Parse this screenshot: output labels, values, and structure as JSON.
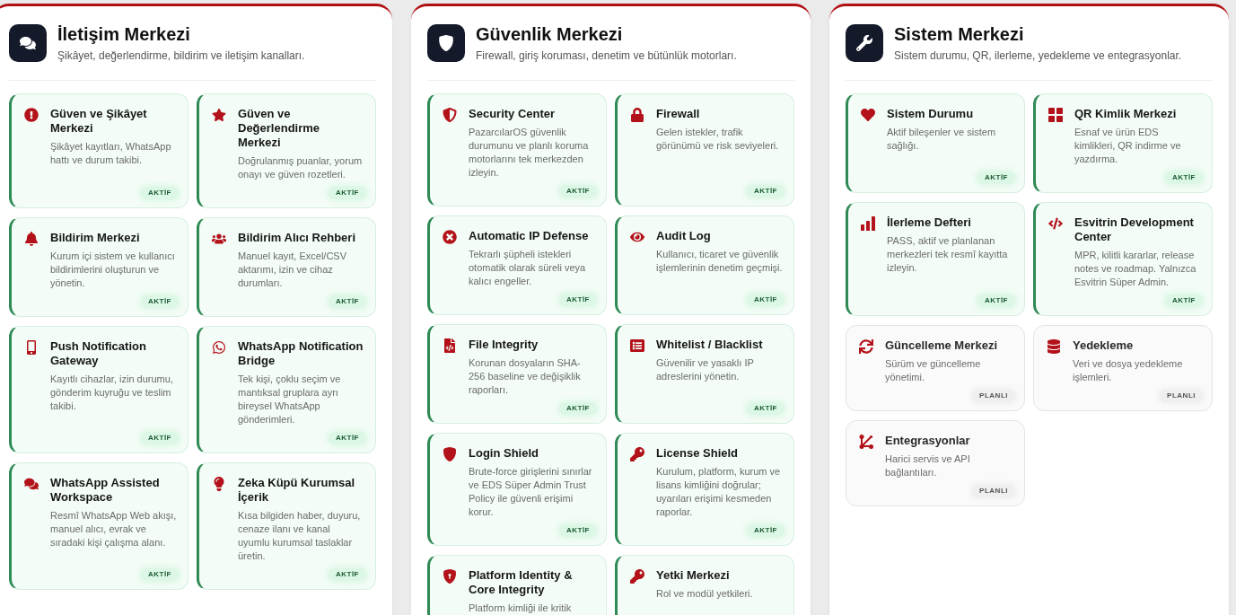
{
  "panels": [
    {
      "title": "İletişim Merkezi",
      "subtitle": "Şikâyet, değerlendirme, bildirim ve iletişim kanalları.",
      "cards": [
        {
          "title": "Güven ve Şikâyet Merkezi",
          "description": "Şikâyet kayıtları, WhatsApp hattı ve durum takibi.",
          "kind": "active",
          "badge": "AKTİF"
        },
        {
          "title": "Güven ve Değerlendirme Merkezi",
          "description": "Doğrulanmış puanlar, yorum onayı ve güven rozetleri.",
          "kind": "active",
          "badge": "AKTİF"
        },
        {
          "title": "Bildirim Merkezi",
          "description": "Kurum içi sistem ve kullanıcı bildirimlerini oluşturun ve yönetin.",
          "kind": "active",
          "badge": "AKTİF"
        },
        {
          "title": "Bildirim Alıcı Rehberi",
          "description": "Manuel kayıt, Excel/CSV aktarımı, izin ve cihaz durumları.",
          "kind": "active",
          "badge": "AKTİF"
        },
        {
          "title": "Push Notification Gateway",
          "description": "Kayıtlı cihazlar, izin durumu, gönderim kuyruğu ve teslim takibi.",
          "kind": "active",
          "badge": "AKTİF"
        },
        {
          "title": "WhatsApp Notification Bridge",
          "description": "Tek kişi, çoklu seçim ve mantıksal gruplara ayrı bireysel WhatsApp gönderimleri.",
          "kind": "active",
          "badge": "AKTİF"
        },
        {
          "title": "WhatsApp Assisted Workspace",
          "description": "Resmî WhatsApp Web akışı, manuel alıcı, evrak ve sıradaki kişi çalışma alanı.",
          "kind": "active",
          "badge": "AKTİF"
        },
        {
          "title": "Zeka Küpü Kurumsal İçerik",
          "description": "Kısa bilgiden haber, duyuru, cenaze ilanı ve kanal uyumlu kurumsal taslaklar üretin.",
          "kind": "active",
          "badge": "AKTİF"
        }
      ]
    },
    {
      "title": "Güvenlik Merkezi",
      "subtitle": "Firewall, giriş koruması, denetim ve bütünlük motorları.",
      "cards": [
        {
          "title": "Security Center",
          "description": "PazarcılarOS güvenlik durumunu ve planlı koruma motorlarını tek merkezden izleyin.",
          "kind": "active",
          "badge": "AKTİF"
        },
        {
          "title": "Firewall",
          "description": "Gelen istekler, trafik görünümü ve risk seviyeleri.",
          "kind": "active",
          "badge": "AKTİF"
        },
        {
          "title": "Automatic IP Defense",
          "description": "Tekrarlı şüpheli istekleri otomatik olarak süreli veya kalıcı engeller.",
          "kind": "active",
          "badge": "AKTİF"
        },
        {
          "title": "Audit Log",
          "description": "Kullanıcı, ticaret ve güvenlik işlemlerinin denetim geçmişi.",
          "kind": "active",
          "badge": "AKTİF"
        },
        {
          "title": "File Integrity",
          "description": "Korunan dosyaların SHA-256 baseline ve değişiklik raporları.",
          "kind": "active",
          "badge": "AKTİF"
        },
        {
          "title": "Whitelist / Blacklist",
          "description": "Güvenilir ve yasaklı IP adreslerini yönetin.",
          "kind": "active",
          "badge": "AKTİF"
        },
        {
          "title": "Login Shield",
          "description": "Brute-force girişlerini sınırlar ve EDS Süper Admin Trust Policy ile güvenli erişimi korur.",
          "kind": "active",
          "badge": "AKTİF"
        },
        {
          "title": "License Shield",
          "description": "Kurulum, platform, kurum ve lisans kimliğini doğrular; uyarıları erişimi kesmeden raporlar.",
          "kind": "active",
          "badge": "AKTİF"
        },
        {
          "title": "Platform Identity & Core Integrity",
          "description": "Platform kimliği ile kritik",
          "kind": "active"
        },
        {
          "title": "Yetki Merkezi",
          "description": "Rol ve modül yetkileri.",
          "kind": "active"
        }
      ]
    },
    {
      "title": "Sistem Merkezi",
      "subtitle": "Sistem durumu, QR, ilerleme, yedekleme ve entegrasyonlar.",
      "cards": [
        {
          "title": "Sistem Durumu",
          "description": "Aktif bileşenler ve sistem sağlığı.",
          "kind": "active",
          "badge": "AKTİF"
        },
        {
          "title": "QR Kimlik Merkezi",
          "description": "Esnaf ve ürün EDS kimlikleri, QR indirme ve yazdırma.",
          "kind": "active",
          "badge": "AKTİF"
        },
        {
          "title": "İlerleme Defteri",
          "description": "PASS, aktif ve planlanan merkezleri tek resmî kayıtta izleyin.",
          "kind": "active",
          "badge": "AKTİF"
        },
        {
          "title": "Esvitrin Development Center",
          "description": "MPR, kilitli kararlar, release notes ve roadmap. Yalnızca Esvitrin Süper Admin.",
          "kind": "active",
          "badge": "AKTİF"
        },
        {
          "title": "Güncelleme Merkezi",
          "description": "Sürüm ve güncelleme yönetimi.",
          "kind": "planned",
          "badge": "PLANLI"
        },
        {
          "title": "Yedekleme",
          "description": "Veri ve dosya yedekleme işlemleri.",
          "kind": "planned",
          "badge": "PLANLI"
        },
        {
          "title": "Entegrasyonlar",
          "description": "Harici servis ve API bağlantıları.",
          "kind": "planned",
          "badge": "PLANLI"
        }
      ]
    }
  ]
}
